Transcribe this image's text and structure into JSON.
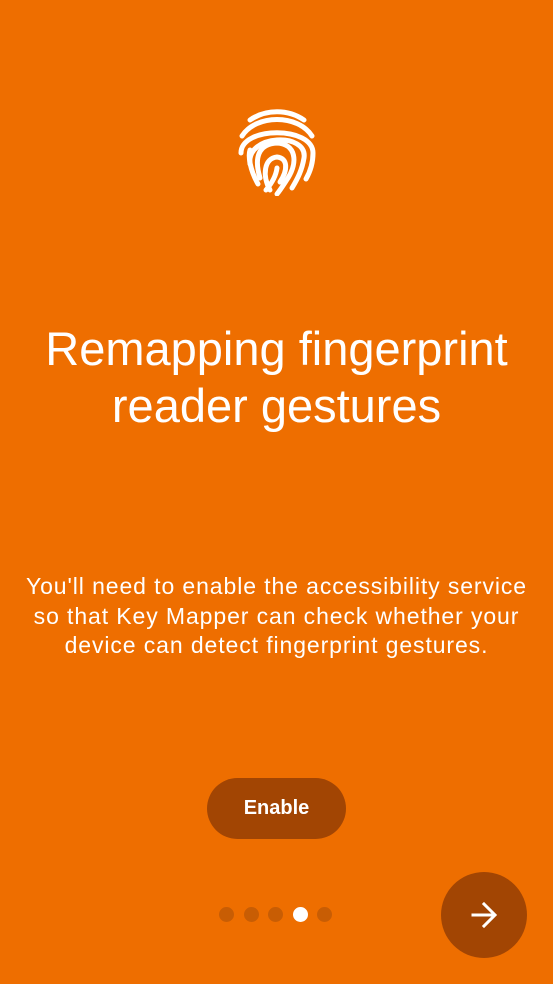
{
  "app": {
    "background_color": "#EE6E00",
    "accent_dark": "#A24503"
  },
  "slide": {
    "icon": "fingerprint-icon",
    "title": "Remapping fingerprint reader gestures",
    "body": "You'll need to enable the accessibility service so that Key Mapper can check whether your device can detect fingerprint gestures."
  },
  "actions": {
    "enable_label": "Enable",
    "next_icon": "arrow-right-icon"
  },
  "pager": {
    "total_pages": 5,
    "current_page": 4,
    "active_color": "#FFFFFF",
    "inactive_color": "#C85D04"
  }
}
